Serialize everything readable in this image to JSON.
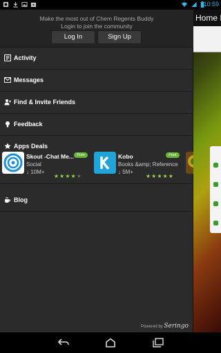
{
  "status_bar": {
    "time": "10:59"
  },
  "background_app": {
    "title": "Home M"
  },
  "drawer": {
    "tagline_1": "Make the most out of Chem Regents Buddy",
    "tagline_2": "Login to join the community",
    "login_label": "Log In",
    "signup_label": "Sign Up",
    "menu": {
      "activity": "Activity",
      "messages": "Messages",
      "find_friends": "Find & Invite Friends",
      "feedback": "Feedback",
      "apps_deals": "Apps Deals",
      "blog": "Blog"
    },
    "deals": [
      {
        "name": "Skout -Chat Me...",
        "category": "Social",
        "downloads": "10M+",
        "badge": "Free",
        "rating": 4
      },
      {
        "name": "Kobo",
        "category": "Books &amp; Reference",
        "downloads": "5M+",
        "badge": "Free",
        "rating": 5
      }
    ],
    "footer": {
      "powered_by": "Powered by",
      "brand": "Seringo"
    }
  },
  "colors": {
    "accent": "#33b5e5",
    "drawer_bg": "#2b2b2b",
    "free_badge": "#6bb33a",
    "star": "#9ad24a"
  }
}
